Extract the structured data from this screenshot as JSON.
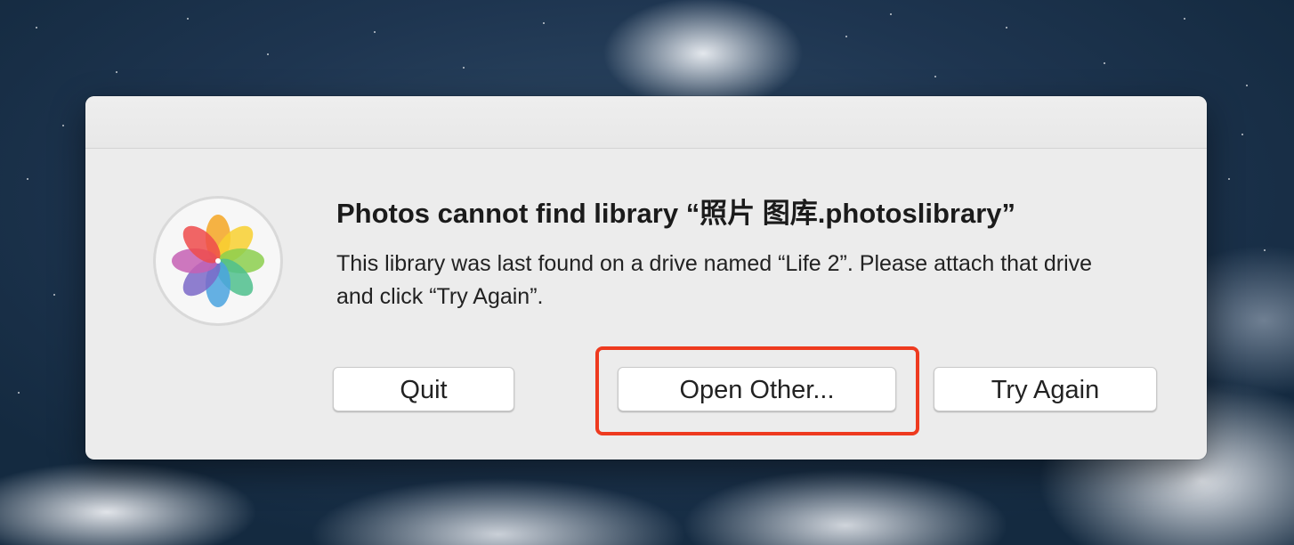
{
  "dialog": {
    "title": "Photos cannot find library “照片 图库.photoslibrary”",
    "message": "This library was last found on a drive named “Life 2”. Please attach that drive and click “Try Again”.",
    "app_icon": "photos-app-icon"
  },
  "buttons": {
    "quit": "Quit",
    "open_other": "Open Other...",
    "try_again": "Try Again"
  },
  "annotation": {
    "highlight_target": "open-other-button",
    "color": "#ee3a1f"
  }
}
